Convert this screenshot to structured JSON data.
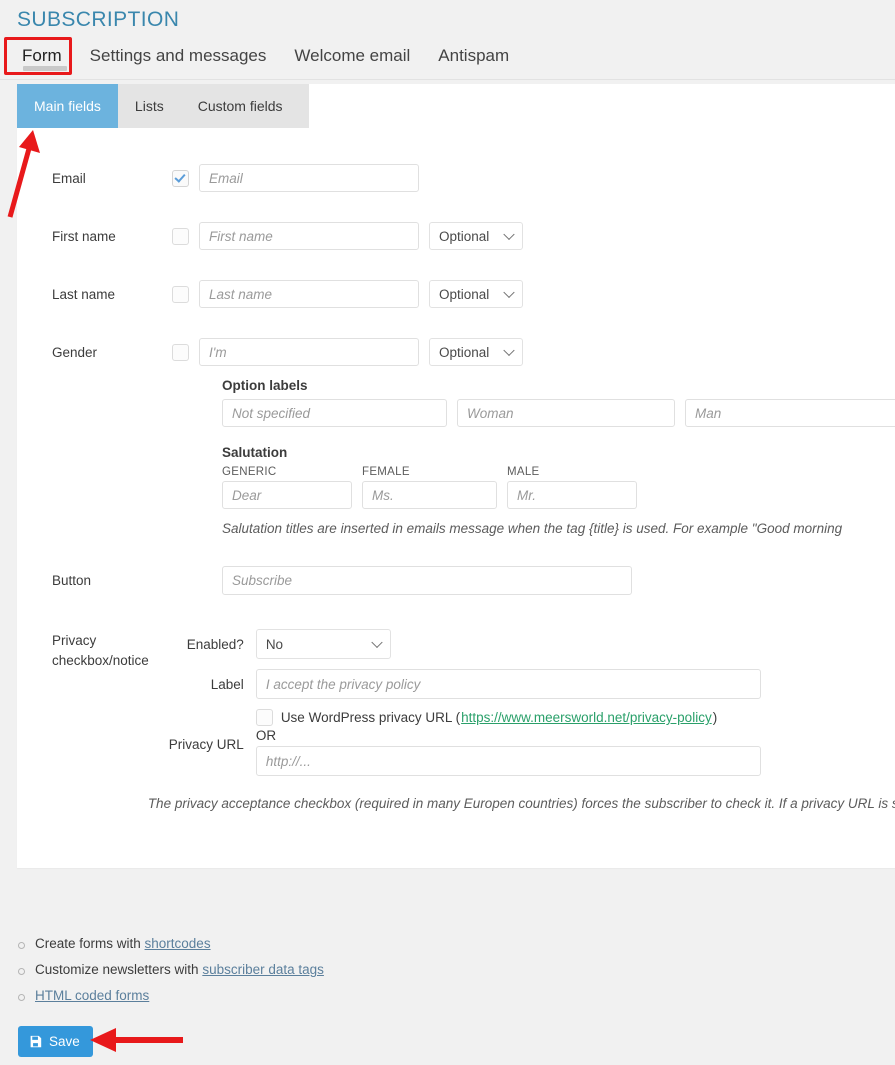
{
  "header": {
    "title": "SUBSCRIPTION",
    "tabs": [
      {
        "label": "Form",
        "active": true
      },
      {
        "label": "Settings and messages",
        "active": false
      },
      {
        "label": "Welcome email",
        "active": false
      },
      {
        "label": "Antispam",
        "active": false
      }
    ]
  },
  "subtabs": [
    {
      "label": "Main fields",
      "active": true
    },
    {
      "label": "Lists",
      "active": false
    },
    {
      "label": "Custom fields",
      "active": false
    }
  ],
  "fields": {
    "email": {
      "label": "Email",
      "checked": true,
      "placeholder": "Email"
    },
    "first_name": {
      "label": "First name",
      "checked": false,
      "placeholder": "First name",
      "requirement": "Optional"
    },
    "last_name": {
      "label": "Last name",
      "checked": false,
      "placeholder": "Last name",
      "requirement": "Optional"
    },
    "gender": {
      "label": "Gender",
      "checked": false,
      "placeholder": "I'm",
      "requirement": "Optional"
    },
    "button": {
      "label": "Button",
      "placeholder": "Subscribe"
    }
  },
  "option_labels": {
    "title": "Option labels",
    "not_specified_placeholder": "Not specified",
    "woman_placeholder": "Woman",
    "man_placeholder": "Man"
  },
  "salutation": {
    "title": "Salutation",
    "generic_head": "GENERIC",
    "female_head": "FEMALE",
    "male_head": "MALE",
    "generic_placeholder": "Dear",
    "female_placeholder": "Ms.",
    "male_placeholder": "Mr.",
    "hint": "Salutation titles are inserted in emails message when the tag {title} is used. For example \"Good morning"
  },
  "privacy": {
    "label": "Privacy checkbox/notice",
    "enabled_label": "Enabled?",
    "enabled_value": "No",
    "label_label": "Label",
    "label_placeholder": "I accept the privacy policy",
    "url_label": "Privacy URL",
    "use_wp_text_before": "Use WordPress privacy URL (",
    "use_wp_link": "https://www.meersworld.net/privacy-policy",
    "use_wp_text_after": ")",
    "use_wp_checked": false,
    "or_text": "OR",
    "url_placeholder": "http://...",
    "hint": "The privacy acceptance checkbox (required in many Europen countries) forces the subscriber to check it. If a privacy URL is specified the label becomes a link."
  },
  "footer": {
    "items": [
      {
        "before": "Create forms with ",
        "link": "shortcodes",
        "after": ""
      },
      {
        "before": "Customize newsletters with ",
        "link": "subscriber data tags",
        "after": ""
      },
      {
        "before": "",
        "link": "HTML coded forms",
        "after": ""
      }
    ],
    "save_label": "Save"
  },
  "colors": {
    "accent_blue": "#3498db",
    "subtab_active": "#6cb3de",
    "title_blue": "#3a87ad",
    "link_green": "#2aa06a",
    "link_blue": "#5b7f9c",
    "annotation_red": "#e8191b"
  }
}
